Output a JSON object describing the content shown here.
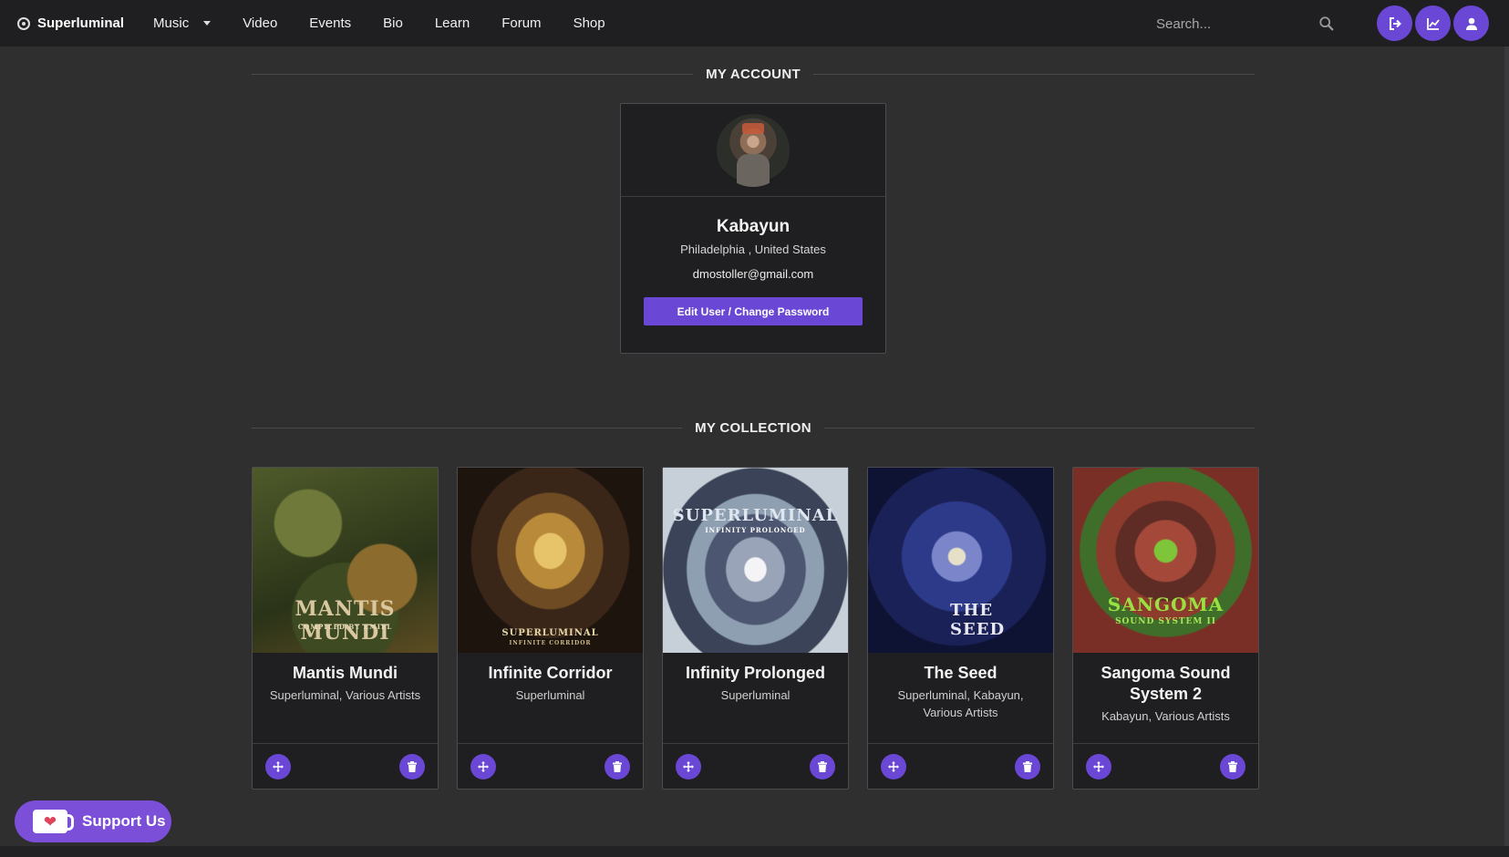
{
  "navbar": {
    "brand": "Superluminal",
    "links": [
      {
        "label": "Music",
        "has_dropdown": true
      },
      {
        "label": "Video"
      },
      {
        "label": "Events"
      },
      {
        "label": "Bio"
      },
      {
        "label": "Learn"
      },
      {
        "label": "Forum"
      },
      {
        "label": "Shop"
      }
    ],
    "search_placeholder": "Search...",
    "icon_buttons": [
      "logout-icon",
      "chart-icon",
      "user-icon"
    ],
    "accent": "#6b47d6"
  },
  "account": {
    "heading": "MY ACCOUNT",
    "name": "Kabayun",
    "location": "Philadelphia , United States",
    "email": "dmostoller@gmail.com",
    "edit_button": "Edit User / Change Password"
  },
  "collection": {
    "heading": "MY COLLECTION",
    "albums": [
      {
        "title": "Mantis Mundi",
        "artists": "Superluminal, Various Artists",
        "cover_text": "MANTIS MUNDI",
        "cover_sub": "COMPILED BY EMIEL"
      },
      {
        "title": "Infinite Corridor",
        "artists": "Superluminal",
        "cover_text": "SUPERLUMINAL",
        "cover_sub": "INFINITE CORRIDOR"
      },
      {
        "title": "Infinity Prolonged",
        "artists": "Superluminal",
        "cover_text": "SUPERLUMINAL",
        "cover_sub": "INFINITY PROLONGED"
      },
      {
        "title": "The Seed",
        "artists": "Superluminal, Kabayun, Various Artists",
        "cover_text": "THE SEED",
        "cover_sub": ""
      },
      {
        "title": "Sangoma Sound System 2",
        "artists": "Kabayun, Various Artists",
        "cover_text": "SANGOMA",
        "cover_sub": "SOUND SYSTEM II"
      }
    ]
  },
  "support": {
    "label": "Support Us"
  }
}
